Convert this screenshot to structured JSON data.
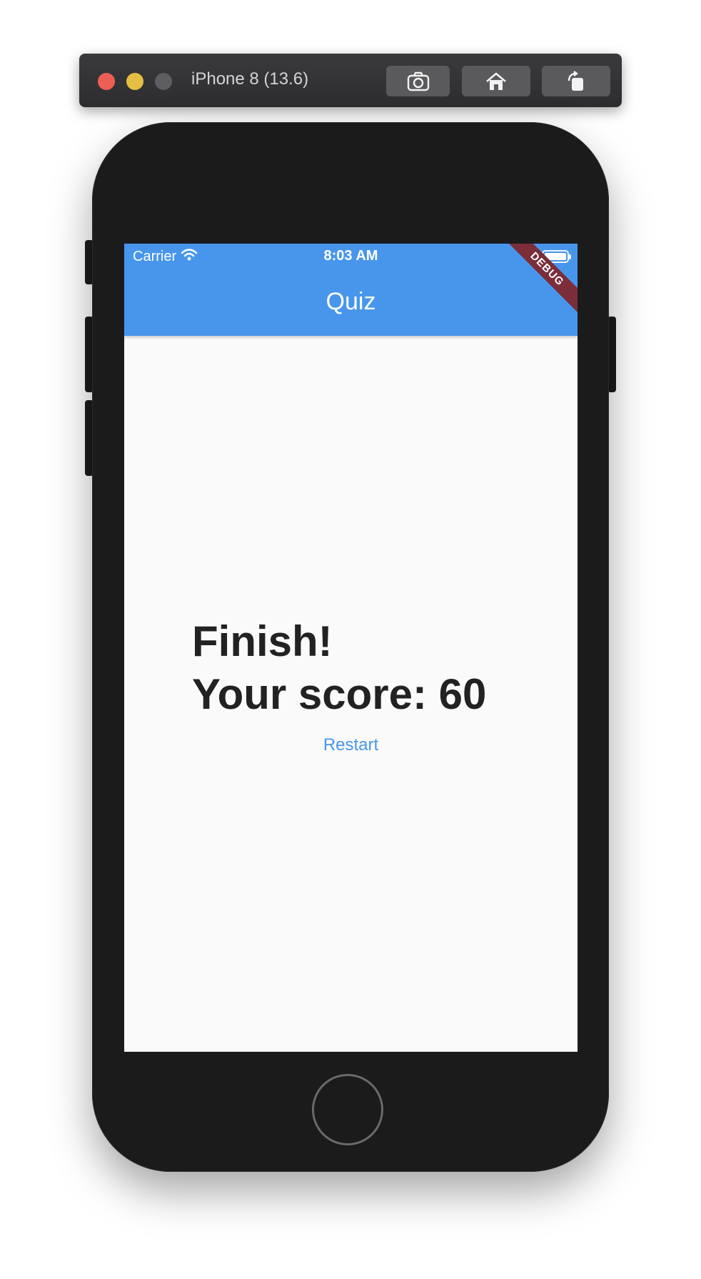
{
  "simulator": {
    "device_title": "iPhone 8 (13.6)",
    "buttons": {
      "screenshot_icon": "camera-icon",
      "home_icon": "home-icon",
      "rotate_icon": "rotate-icon"
    }
  },
  "status_bar": {
    "carrier": "Carrier",
    "time": "8:03 AM"
  },
  "app_bar": {
    "title": "Quiz",
    "debug_banner": "DEBUG",
    "color": "#4896ec"
  },
  "result": {
    "finish_text": "Finish!",
    "score_text": "Your score: 60",
    "restart_label": "Restart"
  }
}
